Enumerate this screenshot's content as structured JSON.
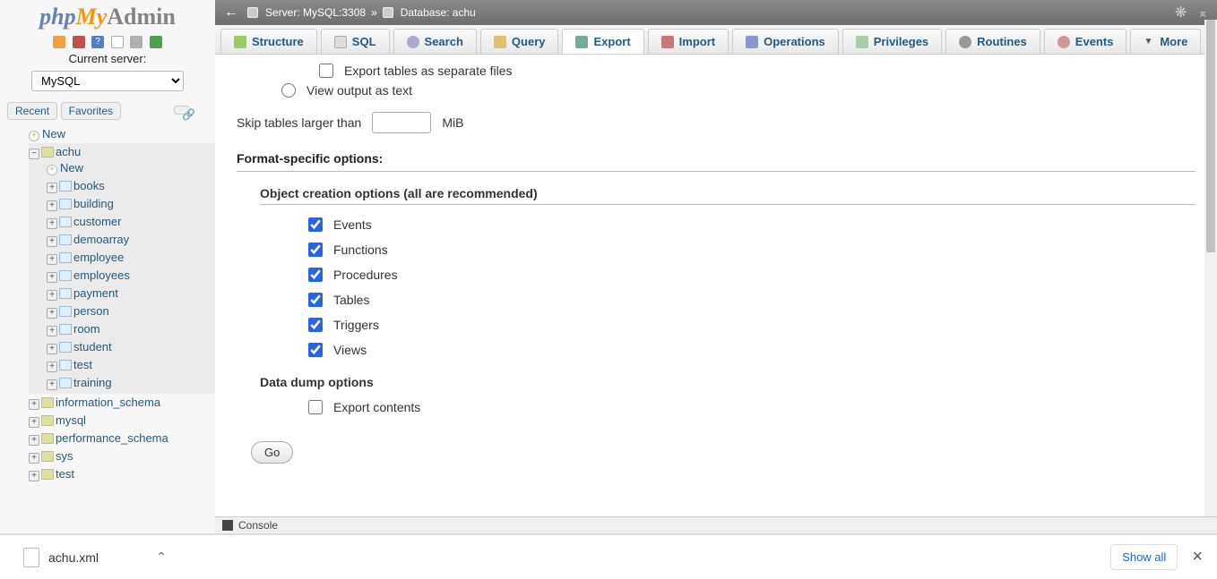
{
  "logo": {
    "p1": "php",
    "p2": "My",
    "p3": "Admin"
  },
  "currentServerLabel": "Current server:",
  "serverSelected": "MySQL",
  "sidebarTabs": {
    "recent": "Recent",
    "favorites": "Favorites"
  },
  "tree": {
    "new": "New",
    "db": "achu",
    "tables": [
      "books",
      "building",
      "customer",
      "demoarray",
      "employee",
      "employees",
      "payment",
      "person",
      "room",
      "student",
      "test",
      "training"
    ],
    "otherDbs": [
      "information_schema",
      "mysql",
      "performance_schema",
      "sys",
      "test"
    ]
  },
  "breadcrumb": {
    "server": "Server: MySQL:3308",
    "sep": "»",
    "db": "Database: achu"
  },
  "tabs": {
    "structure": "Structure",
    "sql": "SQL",
    "search": "Search",
    "query": "Query",
    "export": "Export",
    "import": "Import",
    "operations": "Operations",
    "privileges": "Privileges",
    "routines": "Routines",
    "events": "Events",
    "more": "More"
  },
  "form": {
    "separateFiles": "Export tables as separate files",
    "viewText": "View output as text",
    "skipLabel": "Skip tables larger than",
    "skipUnit": "MiB",
    "formatH": "Format-specific options:",
    "objH": "Object creation options (all are recommended)",
    "objOpts": [
      "Events",
      "Functions",
      "Procedures",
      "Tables",
      "Triggers",
      "Views"
    ],
    "dumpH": "Data dump options",
    "exportContents": "Export contents",
    "go": "Go"
  },
  "console": "Console",
  "download": {
    "file": "achu.xml",
    "showAll": "Show all"
  }
}
